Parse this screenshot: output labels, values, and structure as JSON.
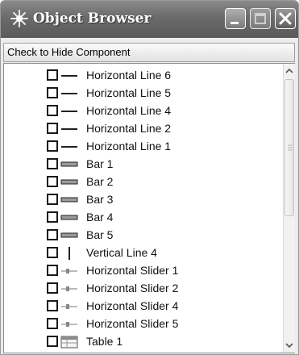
{
  "window": {
    "title": "Object Browser",
    "icons": {
      "app": "sparkle-icon",
      "minimize": "minimize-icon",
      "maximize": "maximize-icon",
      "close": "close-icon"
    }
  },
  "header": {
    "label": "Check to Hide Component"
  },
  "items": [
    {
      "label": "Horizontal Line 6",
      "checked": false,
      "icon": "horizontal-line-icon"
    },
    {
      "label": "Horizontal Line 5",
      "checked": false,
      "icon": "horizontal-line-icon"
    },
    {
      "label": "Horizontal Line 4",
      "checked": false,
      "icon": "horizontal-line-icon"
    },
    {
      "label": "Horizontal Line 2",
      "checked": false,
      "icon": "horizontal-line-icon"
    },
    {
      "label": "Horizontal Line 1",
      "checked": false,
      "icon": "horizontal-line-icon"
    },
    {
      "label": "Bar 1",
      "checked": false,
      "icon": "bar-icon"
    },
    {
      "label": "Bar 2",
      "checked": false,
      "icon": "bar-icon"
    },
    {
      "label": "Bar 3",
      "checked": false,
      "icon": "bar-icon"
    },
    {
      "label": "Bar 4",
      "checked": false,
      "icon": "bar-icon"
    },
    {
      "label": "Bar 5",
      "checked": false,
      "icon": "bar-icon"
    },
    {
      "label": "Vertical Line 4",
      "checked": false,
      "icon": "vertical-line-icon"
    },
    {
      "label": "Horizontal Slider 1",
      "checked": false,
      "icon": "slider-icon"
    },
    {
      "label": "Horizontal Slider 2",
      "checked": false,
      "icon": "slider-icon"
    },
    {
      "label": "Horizontal Slider 4",
      "checked": false,
      "icon": "slider-icon"
    },
    {
      "label": "Horizontal Slider 5",
      "checked": false,
      "icon": "slider-icon"
    },
    {
      "label": "Table 1",
      "checked": false,
      "icon": "table-icon"
    }
  ],
  "scrollbar": {
    "up_icon": "chevron-up-icon",
    "down_icon": "chevron-down-icon"
  }
}
